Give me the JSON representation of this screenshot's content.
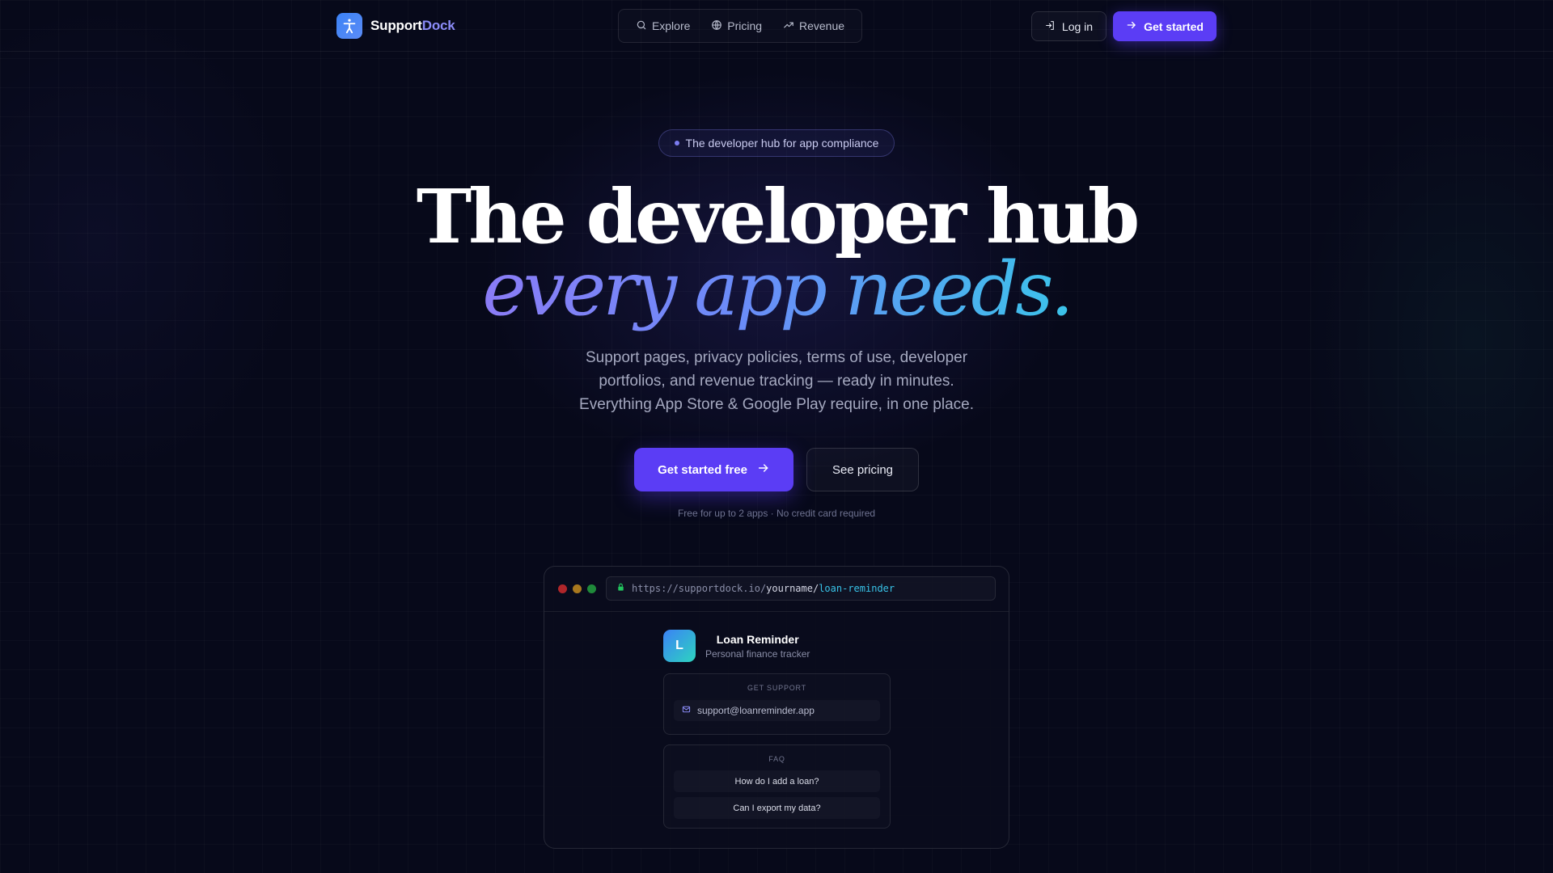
{
  "brand": {
    "name_main": "Support",
    "name_accent": "Dock",
    "logo_icon": "accessibility-figure-icon"
  },
  "nav": {
    "links": [
      {
        "label": "Explore",
        "icon": "search-icon"
      },
      {
        "label": "Pricing",
        "icon": "globe-icon"
      },
      {
        "label": "Revenue",
        "icon": "trending-up-icon"
      }
    ],
    "login_label": "Log in",
    "get_started_label": "Get started"
  },
  "hero": {
    "badge": "The developer hub for app compliance",
    "title_line1": "The developer hub",
    "title_line2": "every app needs.",
    "subtitle_lines": [
      "Support pages, privacy policies, terms of use, developer",
      "portfolios, and revenue tracking — ready in minutes.",
      "Everything App Store & Google Play require, in one place."
    ],
    "cta_primary": "Get started free",
    "cta_secondary": "See pricing",
    "fineprint": "Free for up to 2 apps · No credit card required"
  },
  "preview": {
    "url_base": "https://supportdock.io/",
    "url_user": "yourname/",
    "url_slug": "loan-reminder",
    "app_initial": "L",
    "app_name": "Loan Reminder",
    "app_tagline": "Personal finance tracker",
    "support_label": "GET SUPPORT",
    "support_email": "support@loanreminder.app",
    "faq_label": "FAQ",
    "faq_items": [
      "How do I add a loan?",
      "Can I export my data?"
    ]
  },
  "colors": {
    "accent": "#5b3df5",
    "background": "#07091a",
    "gradient_start": "#8b7cf6",
    "gradient_end": "#3bc3ea",
    "traffic_red": "#b0262a",
    "traffic_yellow": "#a8781e",
    "traffic_green": "#1f8a3a"
  }
}
